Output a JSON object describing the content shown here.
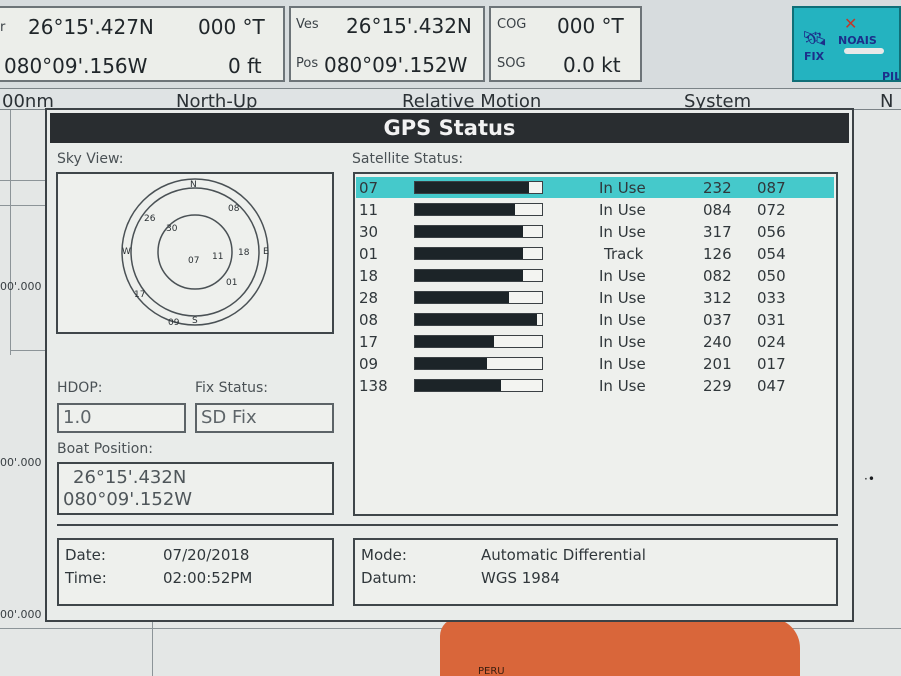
{
  "top": {
    "lat1": "26°15'.427N",
    "heading1": "000 °T",
    "lon1": "080°09'.156W",
    "depth": "0 ft",
    "ves_label": "Ves",
    "pos_label": "Pos",
    "ves_lat": "26°15'.432N",
    "ves_lon": "080°09'.152W",
    "cog_label": "COG",
    "cog_value": "000 °T",
    "sog_label": "SOG",
    "sog_value": "0.0 kt",
    "fix_label": "FIX",
    "noais_label": "NOAIS",
    "pil_label": "PIL"
  },
  "header": {
    "range": "00nm",
    "orientation": "North-Up",
    "motion": "Relative Motion",
    "system": "System",
    "trailing": "N"
  },
  "chart": {
    "lat_labels": [
      "00'.000",
      "00'.000",
      "00'.000"
    ],
    "land_label": "PERU"
  },
  "dialog": {
    "title": "GPS Status",
    "sky_caption": "Sky View:",
    "sat_caption": "Satellite Status:",
    "compass": {
      "n": "N",
      "e": "E",
      "s": "S",
      "w": "W"
    },
    "sky_sats": [
      "26",
      "30",
      "08",
      "07",
      "11",
      "18",
      "01",
      "17",
      "09"
    ],
    "satellites": [
      {
        "id": "07",
        "signal": 0.9,
        "status": "In Use",
        "azimuth": "232",
        "elevation": "087",
        "selected": true
      },
      {
        "id": "11",
        "signal": 0.79,
        "status": "In Use",
        "azimuth": "084",
        "elevation": "072"
      },
      {
        "id": "30",
        "signal": 0.85,
        "status": "In Use",
        "azimuth": "317",
        "elevation": "056"
      },
      {
        "id": "01",
        "signal": 0.85,
        "status": "Track",
        "azimuth": "126",
        "elevation": "054"
      },
      {
        "id": "18",
        "signal": 0.85,
        "status": "In Use",
        "azimuth": "082",
        "elevation": "050"
      },
      {
        "id": "28",
        "signal": 0.74,
        "status": "In Use",
        "azimuth": "312",
        "elevation": "033"
      },
      {
        "id": "08",
        "signal": 0.96,
        "status": "In Use",
        "azimuth": "037",
        "elevation": "031"
      },
      {
        "id": "17",
        "signal": 0.62,
        "status": "In Use",
        "azimuth": "240",
        "elevation": "024"
      },
      {
        "id": "09",
        "signal": 0.57,
        "status": "In Use",
        "azimuth": "201",
        "elevation": "017"
      },
      {
        "id": "138",
        "signal": 0.68,
        "status": "In Use",
        "azimuth": "229",
        "elevation": "047"
      }
    ],
    "hdop_caption": "HDOP:",
    "hdop_value": "1.0",
    "fix_caption": "Fix Status:",
    "fix_value": "SD Fix",
    "boat_caption": "Boat Position:",
    "boat_lat": "26°15'.432N",
    "boat_lon": "080°09'.152W",
    "date_label": "Date:",
    "date_value": "07/20/2018",
    "time_label": "Time:",
    "time_value": "02:00:52PM",
    "mode_label": "Mode:",
    "mode_value": "Automatic Differential",
    "datum_label": "Datum:",
    "datum_value": "WGS 1984"
  },
  "colors": {
    "title_bar": "#292d30",
    "selected_row": "#45c9cb",
    "fix_button": "#24b3c0",
    "land": "#d9663a"
  }
}
